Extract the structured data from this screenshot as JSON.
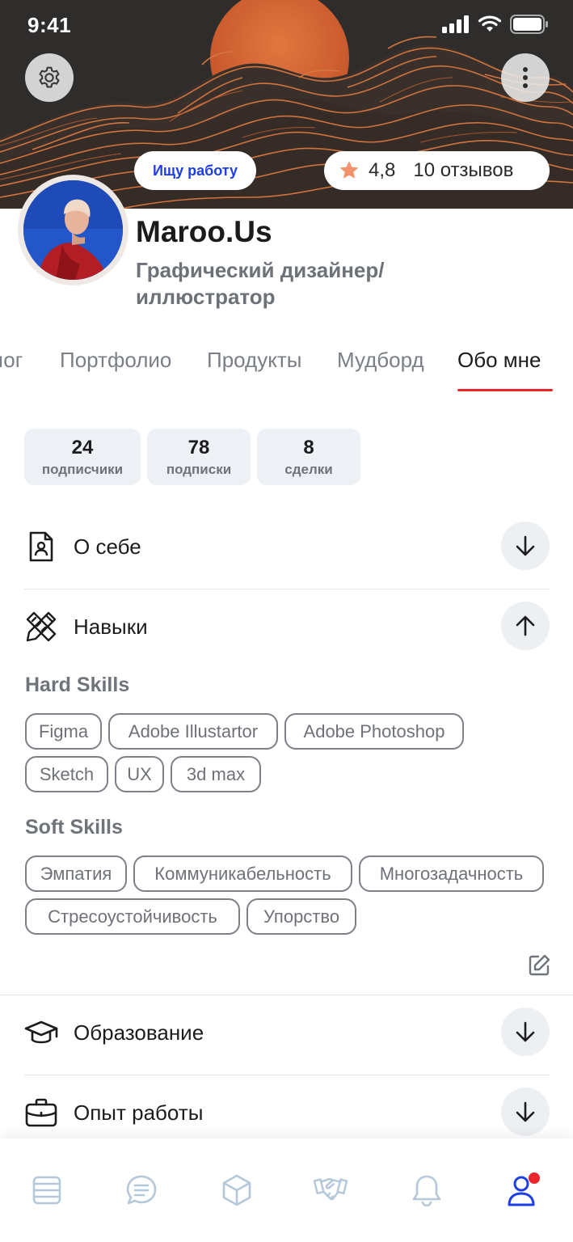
{
  "status_bar": {
    "time": "9:41"
  },
  "header": {
    "job_status": "Ищу работу",
    "rating": "4,8",
    "reviews": "10 отзывов"
  },
  "profile": {
    "name": "Maroo.Us",
    "role": "Графический дизайнер/ иллюстратор"
  },
  "tabs": [
    {
      "label": "Блог"
    },
    {
      "label": "Портфолио"
    },
    {
      "label": "Продукты"
    },
    {
      "label": "Мудборд"
    },
    {
      "label": "Обо мне"
    }
  ],
  "stats": [
    {
      "value": "24",
      "label": "подписчики"
    },
    {
      "value": "78",
      "label": "подписки"
    },
    {
      "value": "8",
      "label": "сделки"
    }
  ],
  "sections": {
    "about": {
      "title": "О себе",
      "icon": "profile-document-icon"
    },
    "skills": {
      "title": "Навыки",
      "icon": "pencil-ruler-icon"
    },
    "education": {
      "title": "Образование",
      "icon": "graduation-cap-icon"
    },
    "experience": {
      "title": "Опыт работы",
      "icon": "briefcase-icon"
    }
  },
  "hard_skills": {
    "title": "Hard Skills",
    "items": [
      "Figma",
      "Adobe Illustartor",
      "Adobe Photoshop",
      "Sketch",
      "UX",
      "3d max"
    ]
  },
  "soft_skills": {
    "title": "Soft Skills",
    "items": [
      "Эмпатия",
      "Коммуникабельность",
      "Многозадачность",
      "Стресоустойчивость",
      "Упорство"
    ]
  },
  "bottom_nav": [
    {
      "name": "feed",
      "icon": "list-icon"
    },
    {
      "name": "messages",
      "icon": "chat-icon"
    },
    {
      "name": "products",
      "icon": "cube-icon"
    },
    {
      "name": "deals",
      "icon": "handshake-icon"
    },
    {
      "name": "notifications",
      "icon": "bell-icon"
    },
    {
      "name": "profile",
      "icon": "user-icon",
      "active": true
    }
  ],
  "colors": {
    "accent_blue": "#1d3ee8",
    "tab_underline": "#e8262c",
    "cover_bg": "#2f2d2c",
    "sun": "#d4622e",
    "star": "#f0926a",
    "nav_inactive": "#b5c8da"
  }
}
